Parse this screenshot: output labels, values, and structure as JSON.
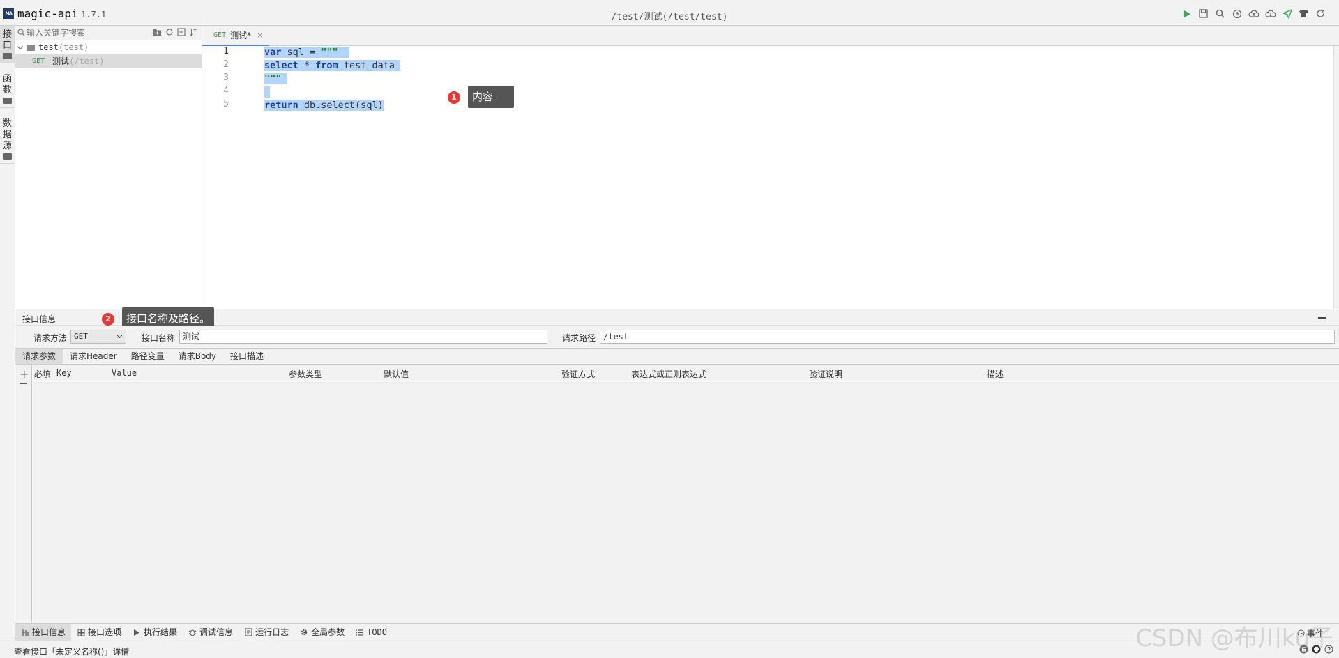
{
  "app": {
    "name": "magic-api",
    "version": "1.7.1",
    "title_path": "/test/测试(/test/test)"
  },
  "colors": {
    "accent": "#4a7fd1",
    "method_get": "#4a9a4a",
    "badge_red": "#e53935",
    "callout_bg": "#555555",
    "selection": "#b3d4fc"
  },
  "toolbar": {
    "icons": [
      "run-icon",
      "save-icon",
      "search-icon",
      "history-icon",
      "upload-icon",
      "download-icon",
      "send-icon",
      "skin-icon",
      "refresh-icon"
    ]
  },
  "left_strip": {
    "tabs": [
      {
        "label_chars": [
          "接",
          "口"
        ],
        "active": true
      },
      {
        "label_chars": [
          "函",
          "数"
        ],
        "active": false
      },
      {
        "label_chars": [
          "数",
          "据",
          "源"
        ],
        "active": false
      }
    ]
  },
  "explorer": {
    "search_placeholder": "输入关键字搜索",
    "group": {
      "name": "test",
      "path": "(test)"
    },
    "api": {
      "method": "GET",
      "name": "测试",
      "path": "(/test)"
    }
  },
  "editor": {
    "tab": {
      "method": "GET",
      "name": "测试*",
      "close": "×"
    },
    "line_numbers": [
      "1",
      "2",
      "3",
      "4",
      "5"
    ]
  },
  "callouts": [
    {
      "num": "1",
      "text": "内容"
    },
    {
      "num": "2",
      "text": "接口名称及路径。"
    }
  ],
  "info_panel": {
    "title": "接口信息",
    "method_label": "请求方法",
    "method_value": "GET",
    "name_label": "接口名称",
    "name_value": "测试",
    "path_label": "请求路径",
    "path_value": "/test"
  },
  "sub_tabs": [
    "请求参数",
    "请求Header",
    "路径变量",
    "请求Body",
    "接口描述"
  ],
  "param_columns": [
    "必填",
    "Key",
    "Value",
    "参数类型",
    "默认值",
    "验证方式",
    "表达式或正则表达式",
    "验证说明",
    "描述"
  ],
  "bottom_tools": [
    {
      "label": "接口信息",
      "icon": "info-icon",
      "active": true
    },
    {
      "label": "接口选项",
      "icon": "options-icon",
      "active": false
    },
    {
      "label": "执行结果",
      "icon": "play-icon",
      "active": false
    },
    {
      "label": "调试信息",
      "icon": "debug-icon",
      "active": false
    },
    {
      "label": "运行日志",
      "icon": "log-icon",
      "active": false
    },
    {
      "label": "全局参数",
      "icon": "gear-icon",
      "active": false
    },
    {
      "label": "TODO",
      "icon": "list-icon",
      "active": false
    }
  ],
  "events_label": "事件",
  "status_text": "查看接口「未定义名称()」详情",
  "watermark": "CSDN @布川ku子"
}
